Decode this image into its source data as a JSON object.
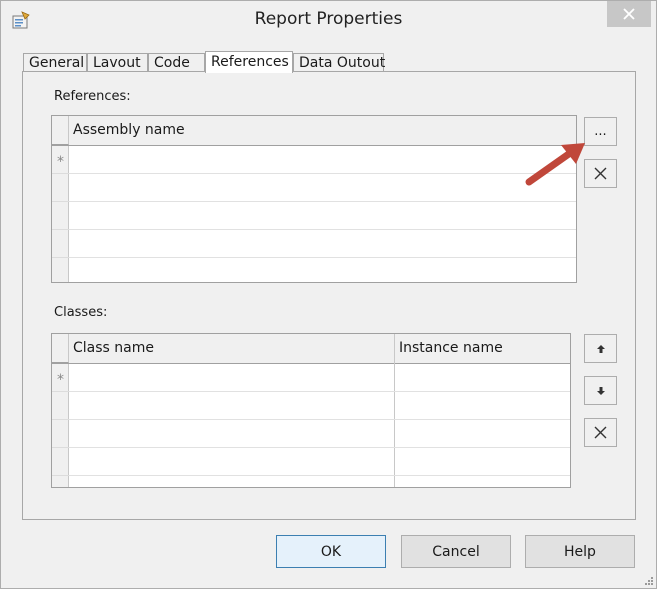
{
  "window": {
    "title": "Report Properties"
  },
  "icons": {
    "app": "properties-icon",
    "close": "close-icon",
    "up": "arrow-up-icon",
    "down": "arrow-down-icon",
    "delete": "delete-x-icon",
    "grip": "resize-grip-icon"
  },
  "tabs": [
    {
      "label": "General"
    },
    {
      "label": "Lavout"
    },
    {
      "label": "Code"
    },
    {
      "label": "References"
    },
    {
      "label": "Data Outout"
    }
  ],
  "active_tab": "References",
  "references": {
    "label": "References:",
    "column": "Assembly name",
    "new_row_marker": "*",
    "browse_label": "..."
  },
  "classes": {
    "label": "Classes:",
    "columns": [
      "Class name",
      "Instance name"
    ],
    "new_row_marker": "*"
  },
  "buttons": {
    "ok": "OK",
    "cancel": "Cancel",
    "help": "Help"
  },
  "colors": {
    "annotation_arrow": "#c0473a",
    "default_button_border": "#3c7fb1"
  }
}
